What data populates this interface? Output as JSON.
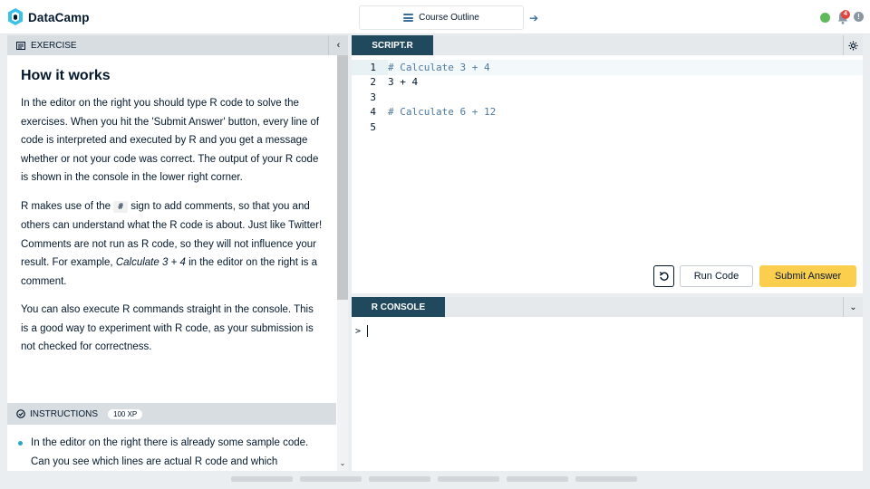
{
  "app": {
    "name": "DataCamp"
  },
  "topbar": {
    "course_outline_label": "Course Outline",
    "notification_count": "4",
    "alert_symbol": "!"
  },
  "exercise": {
    "header_label": "EXERCISE",
    "title": "How it works",
    "paragraphs": [
      "In the editor on the right you should type R code to solve the exercises. When you hit the 'Submit Answer' button, every line of code is interpreted and executed by R and you get a message whether or not your code was correct. The output of your R code is shown in the console in the lower right corner.",
      "You can also execute R commands straight in the console. This is a good way to experiment with R code, as your submission is not checked for correctness."
    ],
    "p2_part1": "R makes use of the ",
    "p2_code": "#",
    "p2_part2": " sign to add comments, so that you and others can understand what the R code is about. Just like Twitter! Comments are not run as R code, so they will not influence your result. For example, ",
    "p2_italic": "Calculate 3 + 4",
    "p2_part3": " in the editor on the right is a comment."
  },
  "instructions": {
    "header_label": "INSTRUCTIONS",
    "xp": "100 XP",
    "items": [
      "In the editor on the right there is already some sample code. Can you see which lines are actual R code and which"
    ]
  },
  "editor": {
    "tab_label": "SCRIPT.R",
    "lines": [
      {
        "num": "1",
        "text": "# Calculate 3 + 4"
      },
      {
        "num": "2",
        "text": "3 + 4"
      },
      {
        "num": "3",
        "text": ""
      },
      {
        "num": "4",
        "text": "# Calculate 6 + 12"
      },
      {
        "num": "5",
        "text": ""
      }
    ],
    "run_label": "Run Code",
    "submit_label": "Submit Answer"
  },
  "console": {
    "tab_label": "R CONSOLE",
    "prompt": ">"
  },
  "colors": {
    "accent_dark": "#21495e",
    "submit_yellow": "#fcce4e",
    "status_green": "#5eb95a",
    "notification_red": "#e6433d",
    "bullet_teal": "#2aa7c7"
  }
}
